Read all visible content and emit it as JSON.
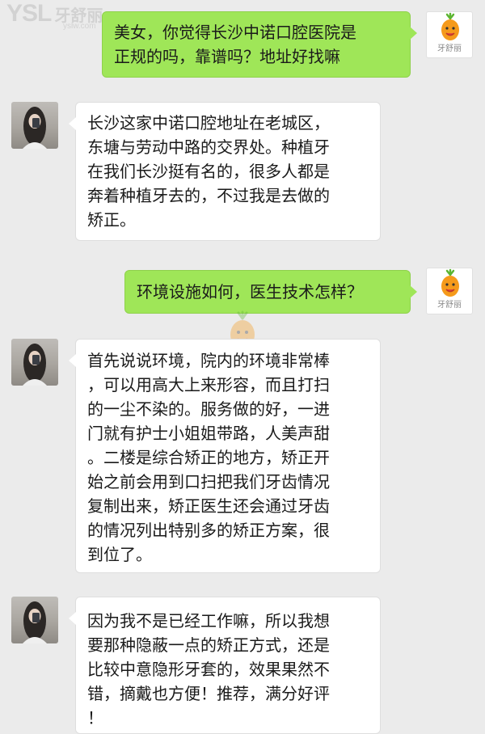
{
  "watermark": {
    "brand": "YSL",
    "name_cn": "牙舒丽",
    "url": "yslw.com"
  },
  "logo_label": "牙舒丽",
  "messages": [
    {
      "sender": "me",
      "text": "美女，你觉得长沙中诺口腔医院是\n正规的吗，靠谱吗？地址好找嘛"
    },
    {
      "sender": "other",
      "text": "长沙这家中诺口腔地址在老城区，\n东塘与劳动中路的交界处。种植牙\n在我们长沙挺有名的，很多人都是\n奔着种植牙去的，不过我是去做的\n矫正。"
    },
    {
      "sender": "me",
      "text": "环境设施如何，医生技术怎样？"
    },
    {
      "sender": "other",
      "text": "首先说说环境，院内的环境非常棒\n，可以用高大上来形容，而且打扫\n的一尘不染的。服务做的好，一进\n门就有护士小姐姐带路，人美声甜\n。二楼是综合矫正的地方，矫正开\n始之前会用到口扫把我们牙齿情况\n复制出来，矫正医生还会通过牙齿\n的情况列出特别多的矫正方案，很\n到位了。"
    },
    {
      "sender": "other",
      "text": "因为我不是已经工作嘛，所以我想\n要那种隐蔽一点的矫正方式，还是\n比较中意隐形牙套的，效果果然不\n错，摘戴也方便！推荐，满分好评\n！"
    }
  ],
  "colors": {
    "me_bubble": "#9fe658",
    "other_bubble": "#ffffff",
    "background": "#ebebeb"
  }
}
